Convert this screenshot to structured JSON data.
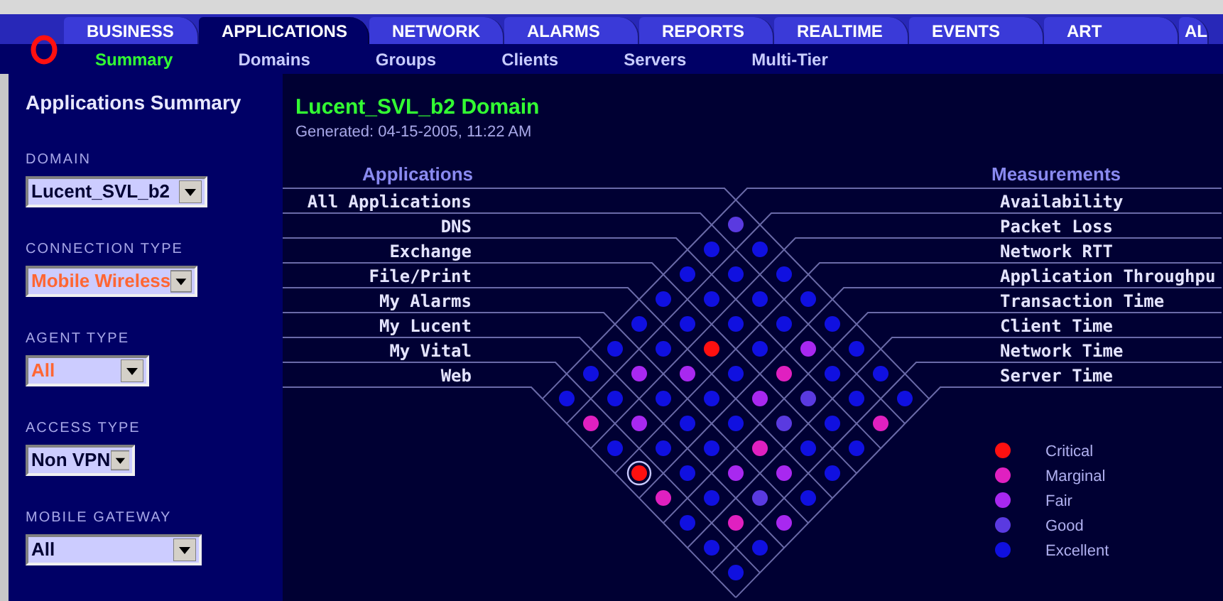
{
  "tabs": [
    {
      "label": "BUSINESS",
      "selected": false
    },
    {
      "label": "APPLICATIONS",
      "selected": true
    },
    {
      "label": "NETWORK",
      "selected": false
    },
    {
      "label": "ALARMS",
      "selected": false
    },
    {
      "label": "REPORTS",
      "selected": false
    },
    {
      "label": "REALTIME",
      "selected": false
    },
    {
      "label": "EVENTS",
      "selected": false
    },
    {
      "label": "ART",
      "selected": false
    },
    {
      "label": "AL",
      "selected": false
    }
  ],
  "subtabs": [
    {
      "label": "Summary",
      "selected": true
    },
    {
      "label": "Domains",
      "selected": false
    },
    {
      "label": "Groups",
      "selected": false
    },
    {
      "label": "Clients",
      "selected": false
    },
    {
      "label": "Servers",
      "selected": false
    },
    {
      "label": "Multi-Tier",
      "selected": false
    }
  ],
  "sidebar": {
    "title": "Applications Summary",
    "filters": [
      {
        "label": "DOMAIN",
        "value": "Lucent_SVL_b2",
        "highlighted": false
      },
      {
        "label": "CONNECTION TYPE",
        "value": "Mobile Wireless",
        "highlighted": true
      },
      {
        "label": "AGENT TYPE",
        "value": "All",
        "highlighted": true
      },
      {
        "label": "ACCESS TYPE",
        "value": "Non VPN",
        "highlighted": false
      },
      {
        "label": "MOBILE GATEWAY",
        "value": "All",
        "highlighted": false
      }
    ]
  },
  "main": {
    "title": "Lucent_SVL_b2 Domain",
    "generated": "Generated: 04-15-2005, 11:22 AM",
    "matrix": {
      "applications_heading": "Applications",
      "measurements_heading": "Measurements",
      "measurements": [
        "Availability",
        "Packet Loss",
        "Network RTT",
        "Application Throughpu",
        "Transaction Time",
        "Client Time",
        "Network Time",
        "Server Time"
      ],
      "rows": [
        {
          "application": "All Applications",
          "cells": [
            {
              "kind": "good",
              "selected": false
            },
            {
              "kind": "excellent",
              "selected": false
            },
            {
              "kind": "excellent",
              "selected": false
            },
            {
              "kind": "excellent",
              "selected": false
            },
            {
              "kind": "excellent",
              "selected": false
            },
            {
              "kind": "excellent",
              "selected": false
            },
            {
              "kind": "excellent",
              "selected": false
            },
            {
              "kind": "excellent",
              "selected": false
            }
          ]
        },
        {
          "application": "DNS",
          "cells": [
            {
              "kind": "excellent",
              "selected": false
            },
            {
              "kind": "excellent",
              "selected": false
            },
            {
              "kind": "excellent",
              "selected": false
            },
            {
              "kind": "excellent",
              "selected": false
            },
            {
              "kind": "fair",
              "selected": false
            },
            {
              "kind": "excellent",
              "selected": false
            },
            {
              "kind": "excellent",
              "selected": false
            },
            {
              "kind": "marginal",
              "selected": false
            }
          ]
        },
        {
          "application": "Exchange",
          "cells": [
            {
              "kind": "excellent",
              "selected": false
            },
            {
              "kind": "excellent",
              "selected": false
            },
            {
              "kind": "excellent",
              "selected": false
            },
            {
              "kind": "excellent",
              "selected": false
            },
            {
              "kind": "marginal",
              "selected": false
            },
            {
              "kind": "good",
              "selected": false
            },
            {
              "kind": "excellent",
              "selected": false
            },
            {
              "kind": "excellent",
              "selected": false
            }
          ]
        },
        {
          "application": "File/Print",
          "cells": [
            {
              "kind": "excellent",
              "selected": false
            },
            {
              "kind": "excellent",
              "selected": false
            },
            {
              "kind": "critical",
              "selected": false
            },
            {
              "kind": "excellent",
              "selected": false
            },
            {
              "kind": "fair",
              "selected": false
            },
            {
              "kind": "good",
              "selected": false
            },
            {
              "kind": "excellent",
              "selected": false
            },
            {
              "kind": "excellent",
              "selected": false
            }
          ]
        },
        {
          "application": "My Alarms",
          "cells": [
            {
              "kind": "excellent",
              "selected": false
            },
            {
              "kind": "excellent",
              "selected": false
            },
            {
              "kind": "fair",
              "selected": false
            },
            {
              "kind": "excellent",
              "selected": false
            },
            {
              "kind": "excellent",
              "selected": false
            },
            {
              "kind": "marginal",
              "selected": false
            },
            {
              "kind": "fair",
              "selected": false
            },
            {
              "kind": "excellent",
              "selected": false
            }
          ]
        },
        {
          "application": "My Lucent",
          "cells": [
            {
              "kind": "excellent",
              "selected": false
            },
            {
              "kind": "fair",
              "selected": false
            },
            {
              "kind": "excellent",
              "selected": false
            },
            {
              "kind": "excellent",
              "selected": false
            },
            {
              "kind": "excellent",
              "selected": false
            },
            {
              "kind": "fair",
              "selected": false
            },
            {
              "kind": "good",
              "selected": false
            },
            {
              "kind": "fair",
              "selected": false
            }
          ]
        },
        {
          "application": "My Vital",
          "cells": [
            {
              "kind": "excellent",
              "selected": false
            },
            {
              "kind": "excellent",
              "selected": false
            },
            {
              "kind": "fair",
              "selected": false
            },
            {
              "kind": "excellent",
              "selected": false
            },
            {
              "kind": "excellent",
              "selected": false
            },
            {
              "kind": "excellent",
              "selected": false
            },
            {
              "kind": "marginal",
              "selected": false
            },
            {
              "kind": "excellent",
              "selected": false
            }
          ]
        },
        {
          "application": "Web",
          "cells": [
            {
              "kind": "excellent",
              "selected": false
            },
            {
              "kind": "marginal",
              "selected": false
            },
            {
              "kind": "excellent",
              "selected": false
            },
            {
              "kind": "critical",
              "selected": true
            },
            {
              "kind": "marginal",
              "selected": false
            },
            {
              "kind": "excellent",
              "selected": false
            },
            {
              "kind": "excellent",
              "selected": false
            },
            {
              "kind": "excellent",
              "selected": false
            }
          ]
        }
      ]
    },
    "legend": [
      {
        "kind": "critical",
        "label": "Critical",
        "color": "#ff1010"
      },
      {
        "kind": "marginal",
        "label": "Marginal",
        "color": "#e020c0"
      },
      {
        "kind": "fair",
        "label": "Fair",
        "color": "#a828f0"
      },
      {
        "kind": "good",
        "label": "Good",
        "color": "#5a3ae0"
      },
      {
        "kind": "excellent",
        "label": "Excellent",
        "color": "#1010e0"
      }
    ]
  }
}
